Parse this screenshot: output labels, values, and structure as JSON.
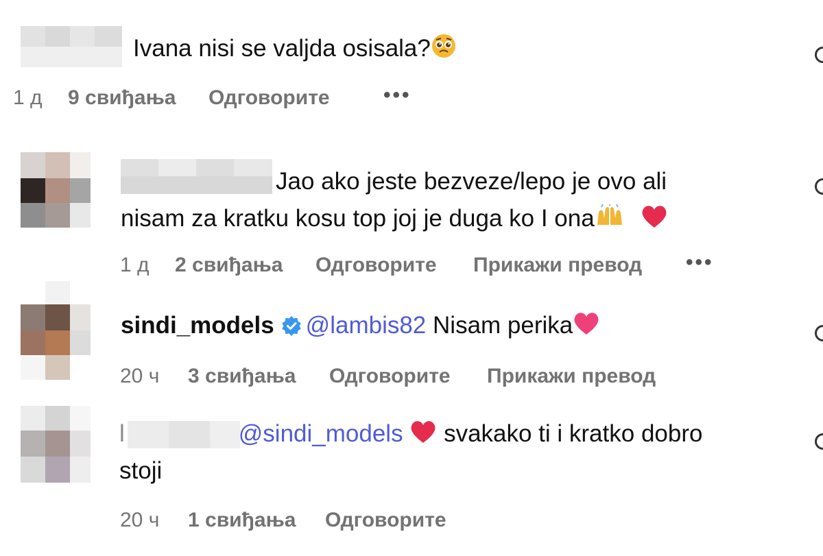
{
  "colors": {
    "mention": "#4f5bd5",
    "meta": "#737373",
    "verified": "#3897f0",
    "heart": "#e0245e"
  },
  "comments": [
    {
      "text": "Ivana nisi se valjda osisala?",
      "emoji": "pleading-face",
      "meta": {
        "time": "1 д",
        "likes": "9 свиђања",
        "reply": "Одговорите",
        "more": "•••"
      }
    },
    {
      "username_visible": "",
      "text_line1": "Jao ako jeste bezveze/lepo je ovo ali",
      "text_line2": "nisam za kratku kosu top joj je duga ko I ona",
      "emojis": [
        "raising-hands",
        "red-heart"
      ],
      "meta": {
        "time": "1 д",
        "likes": "2 свиђања",
        "reply": "Одговорите",
        "translate": "Прикажи превод",
        "more": "•••"
      }
    },
    {
      "username": "sindi_models",
      "verified": true,
      "mention": "@lambis82",
      "text": "Nisam perika",
      "emoji": "pink-heart",
      "meta": {
        "time": "20 ч",
        "likes": "3 свиђања",
        "reply": "Одговорите",
        "translate": "Прикажи превод"
      }
    },
    {
      "username_visible": "l",
      "mention": "@sindi_models",
      "text_line1": "svakako ti i kratko dobro",
      "text_line2": "stoji",
      "emoji": "red-heart",
      "meta": {
        "time": "20 ч",
        "likes": "1 свиђања",
        "reply": "Одговорите"
      }
    }
  ]
}
